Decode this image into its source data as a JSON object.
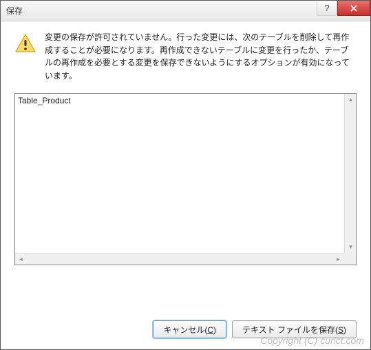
{
  "titlebar": {
    "title": "保存",
    "help_label": "?",
    "close_label": "×"
  },
  "message": {
    "text": "変更の保存が許可されていません。行った変更には、次のテーブルを削除して再作成することが必要になります。再作成できないテーブルに変更を行ったか、テーブルの再作成を必要とする変更を保存できないようにするオプションが有効になっています。"
  },
  "listbox": {
    "items": [
      "Table_Product"
    ]
  },
  "buttons": {
    "cancel_label": "キャンセル(",
    "cancel_key": "C",
    "cancel_close": ")",
    "save_label": "テキスト ファイルを保存(",
    "save_key": "S",
    "save_close": ")"
  },
  "watermark": "Copyright (C) curict.com"
}
